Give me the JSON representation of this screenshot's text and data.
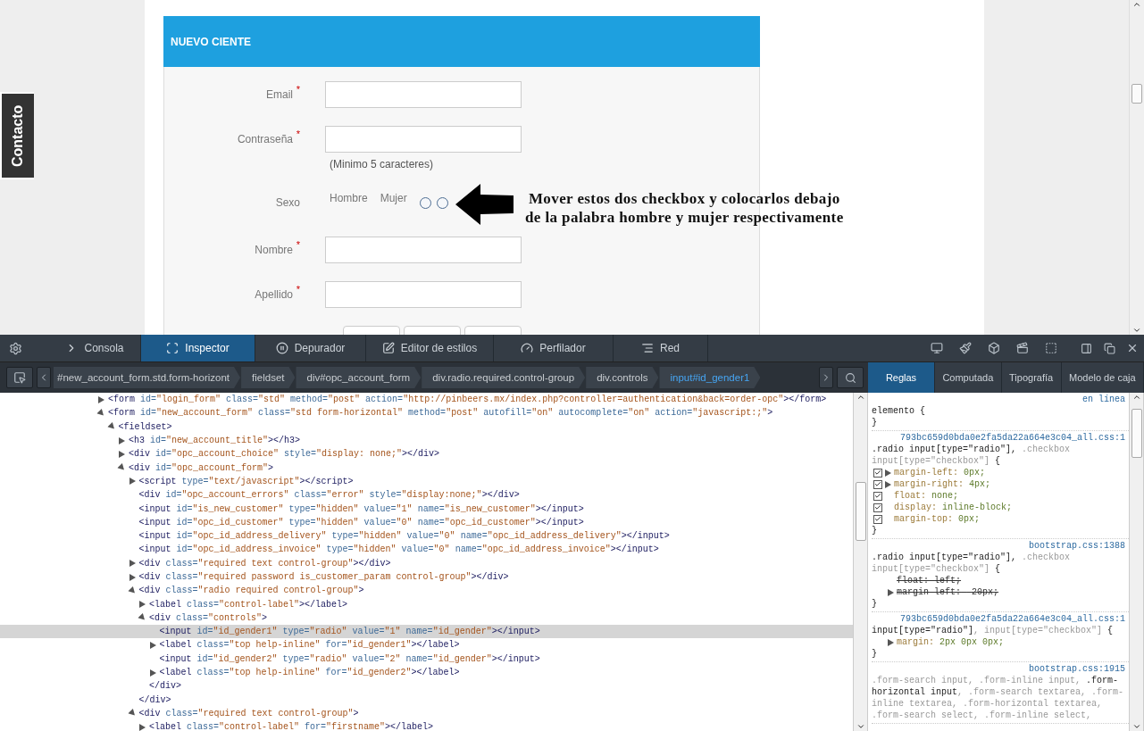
{
  "page": {
    "contact_tab": "Contacto",
    "form": {
      "title": "NUEVO CIENTE",
      "rows": [
        {
          "kind": "text",
          "label": "Email",
          "required_mark": "*"
        },
        {
          "kind": "text",
          "label": "Contraseña",
          "required_mark": "*",
          "hint": "(Minimo 5 caracteres)"
        },
        {
          "kind": "radio",
          "label": "Sexo",
          "options": [
            {
              "label": "Hombre"
            },
            {
              "label": "Mujer"
            }
          ],
          "radios": [
            {
              "checked": false
            },
            {
              "checked": false
            }
          ]
        },
        {
          "kind": "text",
          "label": "Nombre",
          "required_mark": "*"
        },
        {
          "kind": "text",
          "label": "Apellido",
          "required_mark": "*"
        },
        {
          "kind": "date"
        }
      ]
    },
    "annotation": {
      "lines": [
        "Mover estos dos checkbox y colocarlos debajo",
        "de la palabra hombre y mujer respectivamente"
      ]
    }
  },
  "devtools": {
    "tabs": [
      {
        "label": "Consola",
        "selected": false
      },
      {
        "label": "Inspector",
        "selected": true
      },
      {
        "label": "Depurador",
        "selected": false
      },
      {
        "label": "Editor de estilos",
        "selected": false
      },
      {
        "label": "Perfilador",
        "selected": false
      },
      {
        "label": "Red",
        "selected": false
      }
    ],
    "breadcrumbs": [
      {
        "label": "#new_account_form.std.form-horizont",
        "selected": false
      },
      {
        "label": "fieldset",
        "selected": false
      },
      {
        "label": "div#opc_account_form",
        "selected": false
      },
      {
        "label": "div.radio.required.control-group",
        "selected": false
      },
      {
        "label": "div.controls",
        "selected": false
      },
      {
        "label": "input#id_gender1",
        "selected": true
      }
    ],
    "side_tabs": [
      {
        "label": "Reglas",
        "selected": true
      },
      {
        "label": "Computada",
        "selected": false
      },
      {
        "label": "Tipografía",
        "selected": false
      },
      {
        "label": "Modelo de caja",
        "selected": false
      }
    ],
    "markup": [
      {
        "text": "<form id=\"login_form\" class=\"std\" method=\"post\" action=\"http://pinbeers.mx/index.php?controller=authentication&back=order-opc\"></form>",
        "expanded": false,
        "selected": false
      },
      {
        "text": "<form id=\"new_account_form\" class=\"std form-horizontal\" method=\"post\" autofill=\"on\" autocomplete=\"on\" action=\"javascript:;\">",
        "expanded": true,
        "selected": false,
        "children": [
          {
            "text": "<fieldset>",
            "expanded": true,
            "selected": false,
            "children": [
              {
                "text": "<h3 id=\"new_account_title\"></h3>",
                "expanded": false,
                "selected": false
              },
              {
                "text": "<div id=\"opc_account_choice\" style=\"display: none;\"></div>",
                "expanded": false,
                "selected": false
              },
              {
                "text": "<div id=\"opc_account_form\">",
                "expanded": true,
                "selected": false,
                "children": [
                  {
                    "text": "<script type=\"text/javascript\"></script>",
                    "expanded": false,
                    "selected": false
                  },
                  {
                    "text": "<div id=\"opc_account_errors\" class=\"error\" style=\"display:none;\"></div>",
                    "selected": false
                  },
                  {
                    "text": "<input id=\"is_new_customer\" type=\"hidden\" value=\"1\" name=\"is_new_customer\"></input>",
                    "selected": false
                  },
                  {
                    "text": "<input id=\"opc_id_customer\" type=\"hidden\" value=\"0\" name=\"opc_id_customer\"></input>",
                    "selected": false
                  },
                  {
                    "text": "<input id=\"opc_id_address_delivery\" type=\"hidden\" value=\"0\" name=\"opc_id_address_delivery\"></input>",
                    "selected": false
                  },
                  {
                    "text": "<input id=\"opc_id_address_invoice\" type=\"hidden\" value=\"0\" name=\"opc_id_address_invoice\"></input>",
                    "selected": false
                  },
                  {
                    "text": "<div class=\"required text control-group\"></div>",
                    "expanded": false,
                    "selected": false
                  },
                  {
                    "text": "<div class=\"required password is_customer_param control-group\"></div>",
                    "expanded": false,
                    "selected": false
                  },
                  {
                    "text": "<div class=\"radio required control-group\">",
                    "expanded": true,
                    "selected": false,
                    "close": "</div>",
                    "children": [
                      {
                        "text": "<label class=\"control-label\"></label>",
                        "expanded": false,
                        "selected": false
                      },
                      {
                        "text": "<div class=\"controls\">",
                        "expanded": true,
                        "selected": false,
                        "close": "</div>",
                        "children": [
                          {
                            "text": "<input id=\"id_gender1\" type=\"radio\" value=\"1\" name=\"id_gender\"></input>",
                            "selected": true
                          },
                          {
                            "text": "<label class=\"top help-inline\" for=\"id_gender1\"></label>",
                            "expanded": false,
                            "selected": false
                          },
                          {
                            "text": "<input id=\"id_gender2\" type=\"radio\" value=\"2\" name=\"id_gender\"></input>",
                            "selected": false
                          },
                          {
                            "text": "<label class=\"top help-inline\" for=\"id_gender2\"></label>",
                            "expanded": false,
                            "selected": false
                          }
                        ]
                      }
                    ]
                  },
                  {
                    "text": "<div class=\"required text control-group\">",
                    "expanded": true,
                    "selected": false,
                    "children": [
                      {
                        "text": "<label class=\"control-label\" for=\"firstname\"></label>",
                        "expanded": false,
                        "selected": false
                      }
                    ]
                  }
                ]
              }
            ]
          }
        ]
      }
    ],
    "rules": [
      {
        "source": "en línea",
        "selector": [
          {
            "text": "elemento {",
            "matched": true
          }
        ],
        "close": "}"
      },
      {
        "source": "793bc659d0bda0e2fa5da22a664e3c04_all.css:1",
        "selector": [
          {
            "text": ".radio input[type=\"radio\"],",
            "matched": true
          },
          {
            "text": " .checkbox input[type=\"checkbox\"]",
            "matched": false
          },
          {
            "text": " {",
            "matched": true
          }
        ],
        "declarations": [
          {
            "kind": "toggle",
            "checked": true,
            "expandable": true,
            "property": "margin-left:",
            "value": "0px;"
          },
          {
            "kind": "toggle",
            "checked": true,
            "expandable": true,
            "property": "margin-right:",
            "value": "4px;"
          },
          {
            "kind": "toggle",
            "checked": true,
            "expandable": false,
            "property": "float:",
            "value": "none;"
          },
          {
            "kind": "toggle",
            "checked": true,
            "expandable": false,
            "property": "display:",
            "value": "inline-block;"
          },
          {
            "kind": "toggle",
            "checked": true,
            "expandable": false,
            "property": "margin-top:",
            "value": "0px;"
          }
        ],
        "close": "}"
      },
      {
        "source": "bootstrap.css:1388",
        "selector": [
          {
            "text": ".radio input[type=\"radio\"],",
            "matched": true
          },
          {
            "text": " .checkbox input[type=\"checkbox\"]",
            "matched": false
          },
          {
            "text": " {",
            "matched": true
          }
        ],
        "declarations": [
          {
            "kind": "overridden",
            "expandable": false,
            "property": "float:",
            "value": "left;"
          },
          {
            "kind": "overridden",
            "expandable": true,
            "property": "margin-left:",
            "value": "-20px;"
          }
        ],
        "close": "}"
      },
      {
        "source": "793bc659d0bda0e2fa5da22a664e3c04_all.css:1",
        "selector": [
          {
            "text": "input[type=\"radio\"]",
            "matched": true
          },
          {
            "text": ", input[type=\"checkbox\"]",
            "matched": false
          },
          {
            "text": " {",
            "matched": true
          }
        ],
        "declarations": [
          {
            "kind": "plain",
            "expandable": true,
            "property": "margin:",
            "value": "2px 0px 0px;"
          }
        ],
        "close": "}"
      },
      {
        "source": "bootstrap.css:1915",
        "selector": [
          {
            "text": ".form-search input, .form-inline input, ",
            "matched": false
          },
          {
            "text": ".form-horizontal input",
            "matched": true
          },
          {
            "text": ", .form-search textarea, .form-inline textarea, .form-horizontal textarea, .form-search select, .form-inline select,",
            "matched": false
          }
        ]
      }
    ]
  }
}
